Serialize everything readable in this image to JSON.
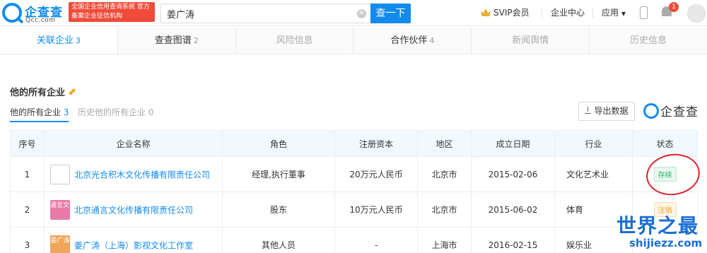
{
  "header": {
    "logo_cn": "企查查",
    "logo_en": "Qcc.com",
    "logo_badge": "全国企业信用查询系统 官方备案企业征信机构",
    "search_value": "姜广涛",
    "search_button": "查一下",
    "svip": "SVIP会员",
    "enterprise_center": "企业中心",
    "apps": "应用",
    "notification_count": "1"
  },
  "tabs": [
    {
      "label": "关联企业",
      "count": "3",
      "state": "active"
    },
    {
      "label": "查查图谱",
      "count": "2",
      "state": "normal"
    },
    {
      "label": "风险信息",
      "count": "",
      "state": "disabled"
    },
    {
      "label": "合作伙伴",
      "count": "4",
      "state": "normal"
    },
    {
      "label": "新闻舆情",
      "count": "",
      "state": "disabled"
    },
    {
      "label": "历史信息",
      "count": "",
      "state": "disabled"
    }
  ],
  "section": {
    "title": "他的所有企业",
    "subtab_all": "他的所有企业",
    "subtab_all_count": "3",
    "subtab_history": "历史他的所有企业 0",
    "export_label": "导出数据",
    "brand_text": "企查查"
  },
  "table": {
    "columns": [
      "序号",
      "企业名称",
      "角色",
      "注册资本",
      "地区",
      "成立日期",
      "行业",
      "状态"
    ],
    "rows": [
      {
        "no": "1",
        "logo_text": "",
        "name": "北京光合积木文化传播有限责任公司",
        "role": "经理,执行董事",
        "capital": "20万元人民币",
        "region": "北京市",
        "date": "2015-02-06",
        "industry": "文化艺术业",
        "status": "存续"
      },
      {
        "no": "2",
        "logo_text": "通言文化",
        "name": "北京通言文化传播有限责任公司",
        "role": "股东",
        "capital": "10万元人民币",
        "region": "北京市",
        "date": "2015-06-02",
        "industry": "体育",
        "status": "注销"
      },
      {
        "no": "3",
        "logo_text": "姜广涛",
        "name": "姜广涛（上海）影视文化工作室",
        "role": "其他人员",
        "capital": "-",
        "region": "上海市",
        "date": "2016-02-15",
        "industry": "娱乐业",
        "status": ""
      }
    ]
  },
  "watermark": {
    "cn": "世界之最",
    "en": "shijiezz.com"
  },
  "colors": {
    "brand_blue": "#128bed",
    "status_active": "#2bb673",
    "status_cancelled": "#f5a623",
    "badge_red": "#f04b3a",
    "annotation_red": "#d9252f"
  }
}
